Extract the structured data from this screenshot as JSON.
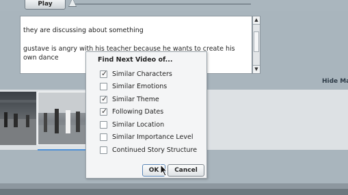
{
  "toolbar": {
    "play_label": "Play",
    "seek_position": 0.0
  },
  "notes": {
    "line1": "they are discussing about something",
    "line2": "gustave is angry with his teacher because he wants to create his",
    "line3": "own dance"
  },
  "scrollbar": {
    "up_icon": "triangle-up",
    "down_icon": "triangle-down"
  },
  "side": {
    "hide_label": "Hide Ma"
  },
  "dialog": {
    "title": "Find Next Video of...",
    "options": [
      {
        "label": "Similar Characters",
        "checked": true
      },
      {
        "label": "Similar Emotions",
        "checked": false
      },
      {
        "label": "Similar Theme",
        "checked": true
      },
      {
        "label": "Following Dates",
        "checked": true
      },
      {
        "label": "Similar Location",
        "checked": false
      },
      {
        "label": "Similar Importance Level",
        "checked": false
      },
      {
        "label": "Continued Story Structure",
        "checked": false
      }
    ],
    "ok_label": "OK",
    "cancel_label": "Cancel"
  },
  "colors": {
    "accent": "#4c8fd6",
    "background": "#a9b5bd"
  }
}
